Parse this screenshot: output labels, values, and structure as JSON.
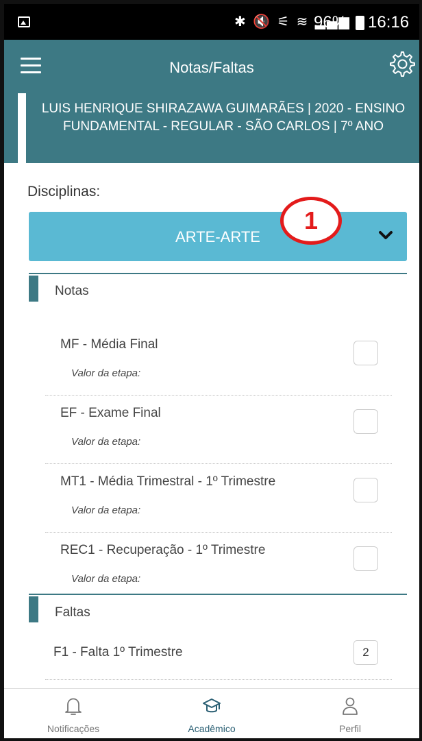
{
  "status_bar": {
    "icons": [
      "gallery-icon",
      "bluetooth-icon",
      "mute-icon",
      "volte-icon",
      "wifi-icon",
      "signal-icon",
      "battery-icon"
    ],
    "indicators": "✱ 🔇 ⚟ ≋ ▂▄▆",
    "battery": "96%",
    "time": "16:16"
  },
  "header": {
    "title": "Notas/Faltas",
    "student_info": "LUIS HENRIQUE SHIRAZAWA GUIMARÃES | 2020 - ENSINO FUNDAMENTAL - REGULAR - SÃO CARLOS | 7º ANO"
  },
  "disciplines": {
    "label": "Disciplinas:",
    "selected": "ARTE-ARTE",
    "marker": "1"
  },
  "grades": {
    "title": "Notas",
    "items": [
      {
        "label": "MF - Média Final",
        "sub": "Valor da etapa:"
      },
      {
        "label": "EF - Exame Final",
        "sub": "Valor da etapa:"
      },
      {
        "label": "MT1 - Média Trimestral - 1º Trimestre",
        "sub": "Valor da etapa:"
      },
      {
        "label": "REC1 - Recuperação - 1º Trimestre",
        "sub": "Valor da etapa:"
      }
    ]
  },
  "absences": {
    "title": "Faltas",
    "items": [
      {
        "label": "F1 - Falta 1º Trimestre",
        "value": "2"
      }
    ]
  },
  "nav": {
    "items": [
      {
        "label": "Notificações",
        "icon": "bell-icon"
      },
      {
        "label": "Acadêmico",
        "icon": "graduation-cap-icon",
        "active": true
      },
      {
        "label": "Perfil",
        "icon": "user-icon"
      }
    ]
  },
  "colors": {
    "header": "#3d7984",
    "select": "#5ab9d3",
    "marker": "#e31b1b",
    "active_nav": "#2a5f73"
  }
}
